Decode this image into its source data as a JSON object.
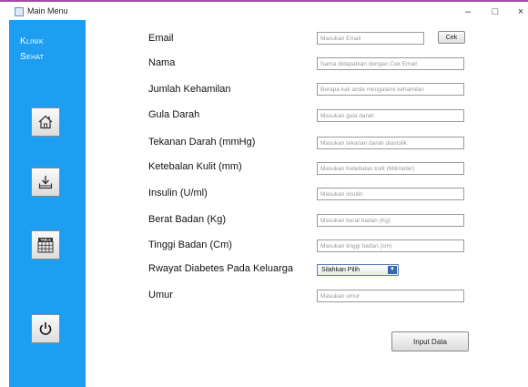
{
  "window": {
    "title": "Main Menu",
    "minimize_glyph": "–",
    "maximize_glyph": "□",
    "close_glyph": "×"
  },
  "colors": {
    "sidebar": "#1d9ef0",
    "window_top_border": "#a24aa8"
  },
  "sidebar": {
    "brand_line1": "Klinik",
    "brand_line2": "Sehat",
    "buttons": [
      {
        "icon": "home-icon"
      },
      {
        "icon": "download-icon"
      },
      {
        "icon": "table-icon"
      },
      {
        "icon": "power-icon"
      }
    ],
    "table_icon_text": "TABLE"
  },
  "form": {
    "fields": [
      {
        "label": "Email",
        "placeholder": "Masukan Email"
      },
      {
        "label": "Nama",
        "placeholder": "Nama didapatkan dengan Cek Email"
      },
      {
        "label": "Jumlah Kehamilan",
        "placeholder": "Berapa kali anda mengalami kehamilan"
      },
      {
        "label": "Gula Darah",
        "placeholder": "Masukan gula darah"
      },
      {
        "label": "Tekanan Darah (mmHg)",
        "placeholder": "Masukan tekanan darah diastolik"
      },
      {
        "label": "Ketebalan Kulit (mm)",
        "placeholder": "Masukan Ketebalan kulit (Milimeter)"
      },
      {
        "label": "Insulin (U/ml)",
        "placeholder": "Masukan insulin"
      },
      {
        "label": "Berat Badan (Kg)",
        "placeholder": "Masukan berat badan (Kg)"
      },
      {
        "label": "Tinggi Badan (Cm)",
        "placeholder": "Masukan tinggi badan (cm)"
      },
      {
        "label": "Rwayat Diabetes Pada Keluarga",
        "selected": "Silahkan Pilih"
      },
      {
        "label": "Umur",
        "placeholder": "Masukan umur"
      }
    ],
    "cek_label": "Cek",
    "submit_label": "Input Data",
    "select_arrow": "▼"
  }
}
